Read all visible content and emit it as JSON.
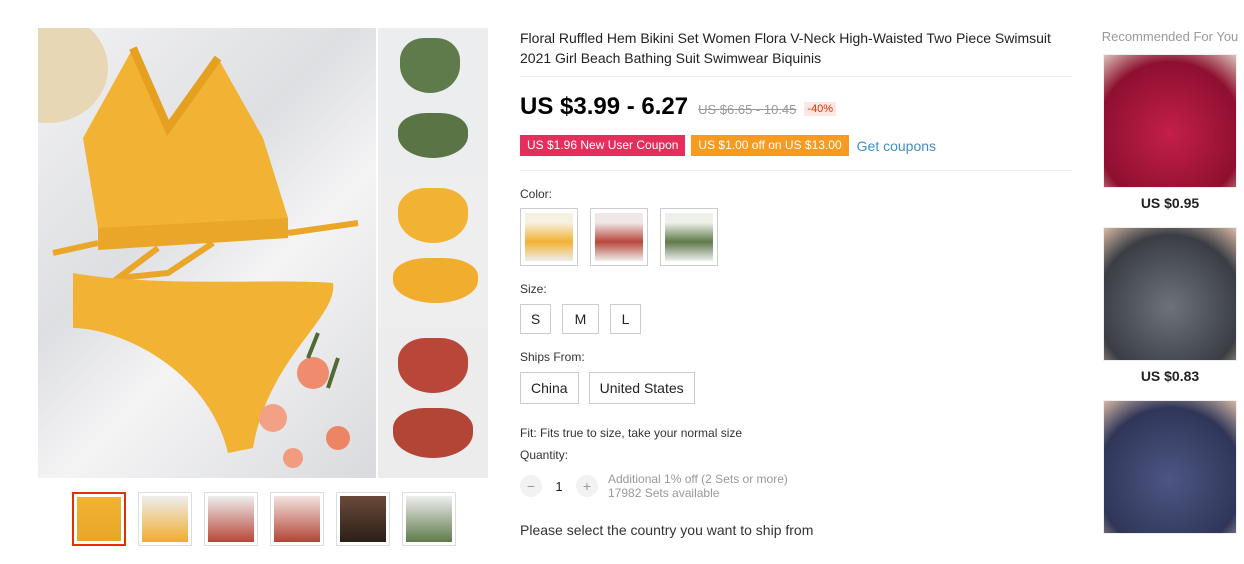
{
  "product": {
    "title": "Floral Ruffled Hem Bikini Set Women Flora V-Neck High-Waisted Two Piece Swimsuit 2021 Girl Beach Bathing Suit Swimwear Biquinis",
    "price": "US $3.99 - 6.27",
    "original_price": "US $6.65 - 10.45",
    "discount": "-40%"
  },
  "coupons": {
    "new_user": "US $1.96 New User Coupon",
    "store": "US $1.00 off on US $13.00",
    "get_link": "Get coupons"
  },
  "color": {
    "label": "Color:",
    "options": [
      "yellow",
      "rust-red",
      "green"
    ]
  },
  "size": {
    "label": "Size:",
    "options": [
      "S",
      "M",
      "L"
    ]
  },
  "ships_from": {
    "label": "Ships From:",
    "options": [
      "China",
      "United States"
    ]
  },
  "fit": "Fit: Fits true to size, take your normal size",
  "quantity": {
    "label": "Quantity:",
    "value": "1",
    "minus": "−",
    "plus": "+",
    "discount_note": "Additional 1% off (2 Sets or more)",
    "available": "17982 Sets available"
  },
  "ship_message": "Please select the country you want to ship from",
  "recommended": {
    "title": "Recommended For You",
    "items": [
      {
        "price": "US $0.95",
        "color": "#a3123a"
      },
      {
        "price": "US $0.83",
        "color": "#4a4f56"
      },
      {
        "color": "#3b4470"
      }
    ]
  },
  "colors": {
    "yellow": "#f2b233",
    "rust": "#b8473a",
    "green": "#5f7a4b",
    "accent": "#e62e04",
    "link": "#3e8fc9"
  }
}
